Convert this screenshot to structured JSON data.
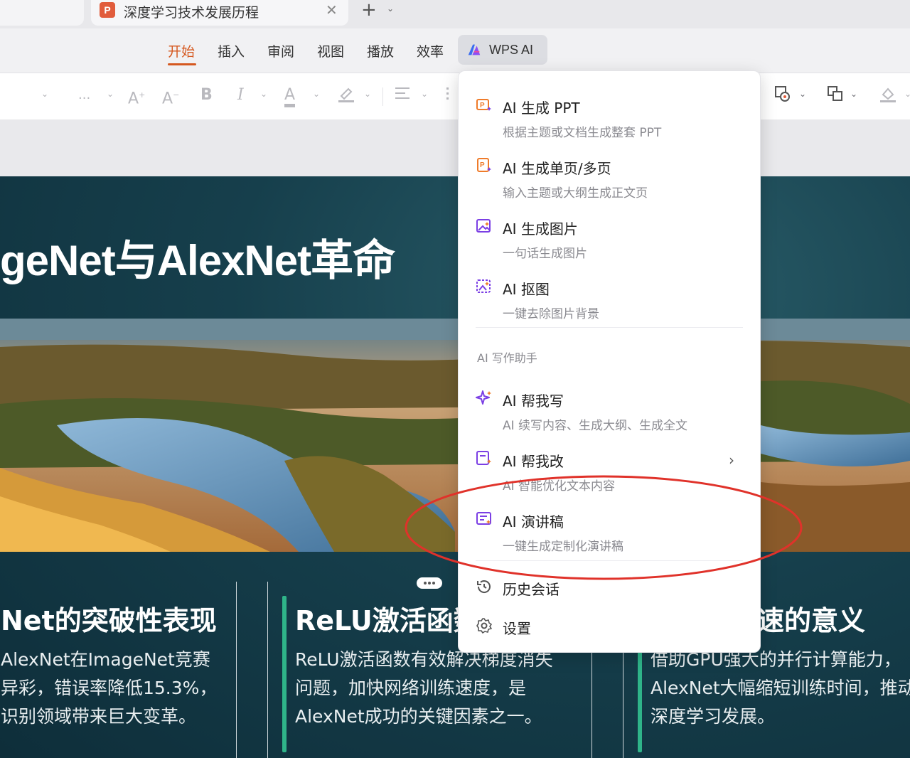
{
  "tab_bar": {
    "doc_icon_letter": "P",
    "doc_title": "深度学习技术发展历程",
    "close_glyph": "✕",
    "new_tab_glyph": "+",
    "new_tab_arrow": "⌄"
  },
  "menu": {
    "items": [
      "开始",
      "插入",
      "审阅",
      "视图",
      "播放",
      "效率"
    ],
    "active_index": 0,
    "wps_ai_label": "WPS AI"
  },
  "toolbar": {
    "ellipsis": "..."
  },
  "slide": {
    "title": "geNet与AlexNet革命",
    "cards": [
      {
        "heading": "Net的突破性表现",
        "body": "AlexNet在ImageNet竞赛\n异彩，错误率降低15.3%，\n识别领域带来巨大变革。"
      },
      {
        "heading": "ReLU激活函数",
        "body": "ReLU激活函数有效解决梯度消失\n问题，加快网络训练速度，是\nAlexNet成功的关键因素之一。"
      },
      {
        "heading": "速的意义",
        "body": "借助GPU强大的并行计算能力，\nAlexNet大幅缩短训练时间，推动\n深度学习发展。"
      }
    ]
  },
  "dropdown": {
    "items": [
      {
        "title": "AI 生成 PPT",
        "subtitle": "根据主题或文档生成整套 PPT",
        "icon": "ai-ppt-icon"
      },
      {
        "title": "AI 生成单页/多页",
        "subtitle": "输入主题或大纲生成正文页",
        "icon": "ai-page-icon"
      },
      {
        "title": "AI 生成图片",
        "subtitle": "一句话生成图片",
        "icon": "ai-image-icon"
      },
      {
        "title": "AI 抠图",
        "subtitle": "一键去除图片背景",
        "icon": "ai-cutout-icon"
      }
    ],
    "section_label": "AI 写作助手",
    "writing_items": [
      {
        "title": "AI 帮我写",
        "subtitle": "AI 续写内容、生成大纲、生成全文",
        "icon": "sparkle-icon"
      },
      {
        "title": "AI 帮我改",
        "subtitle": "AI 智能优化文本内容",
        "icon": "ai-edit-icon",
        "has_submenu": true
      },
      {
        "title": "AI 演讲稿",
        "subtitle": "一键生成定制化演讲稿",
        "icon": "speech-icon"
      }
    ],
    "footer_items": [
      {
        "label": "历史会话",
        "icon": "history-icon"
      },
      {
        "label": "设置",
        "icon": "gear-icon"
      }
    ],
    "submenu_arrow": "›"
  },
  "colors": {
    "accent_orange": "#d5581f",
    "ai_purple": "#7b3fe4",
    "ai_orange": "#ef7b2a",
    "slide_bg": "#163f4c",
    "card_accent": "#2fb489",
    "annotation_red": "#e0322a"
  }
}
